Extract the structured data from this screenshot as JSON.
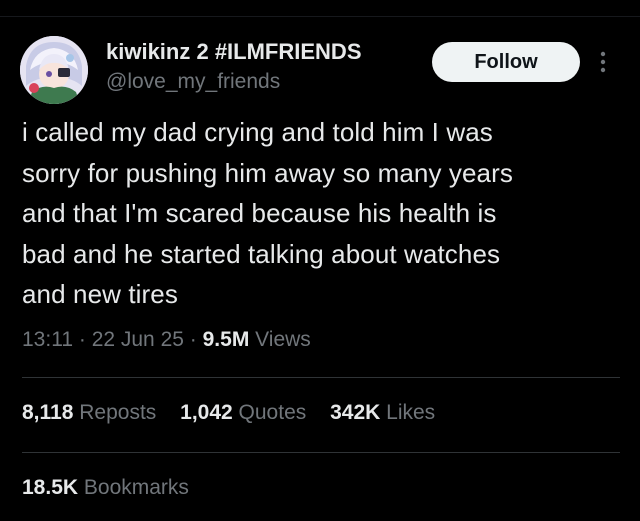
{
  "author": {
    "display_name": "kiwikinz 2 #ILMFRIENDS",
    "handle": "@love_my_friends",
    "avatar_icon": "anime-girl-avatar"
  },
  "follow_label": "Follow",
  "more_icon": "more-vertical-icon",
  "tweet": {
    "lines": [
      "i called my dad crying and told him I was",
      "sorry for pushing him away so many years",
      "and that I'm scared because his health is",
      "bad and he started talking about watches",
      "and new tires"
    ]
  },
  "meta": {
    "time": "13:11",
    "separator": "·",
    "date": "22 Jun 25",
    "views_count": "9.5M",
    "views_label": "Views"
  },
  "stats": {
    "reposts_count": "8,118",
    "reposts_label": "Reposts",
    "quotes_count": "1,042",
    "quotes_label": "Quotes",
    "likes_count": "342K",
    "likes_label": "Likes"
  },
  "bookmarks": {
    "count": "18.5K",
    "label": "Bookmarks"
  },
  "colors": {
    "background": "#000000",
    "primary_text": "#e7e9ea",
    "secondary_text": "#71767b",
    "follow_button_bg": "#eff3f4",
    "divider": "#2f3336"
  }
}
